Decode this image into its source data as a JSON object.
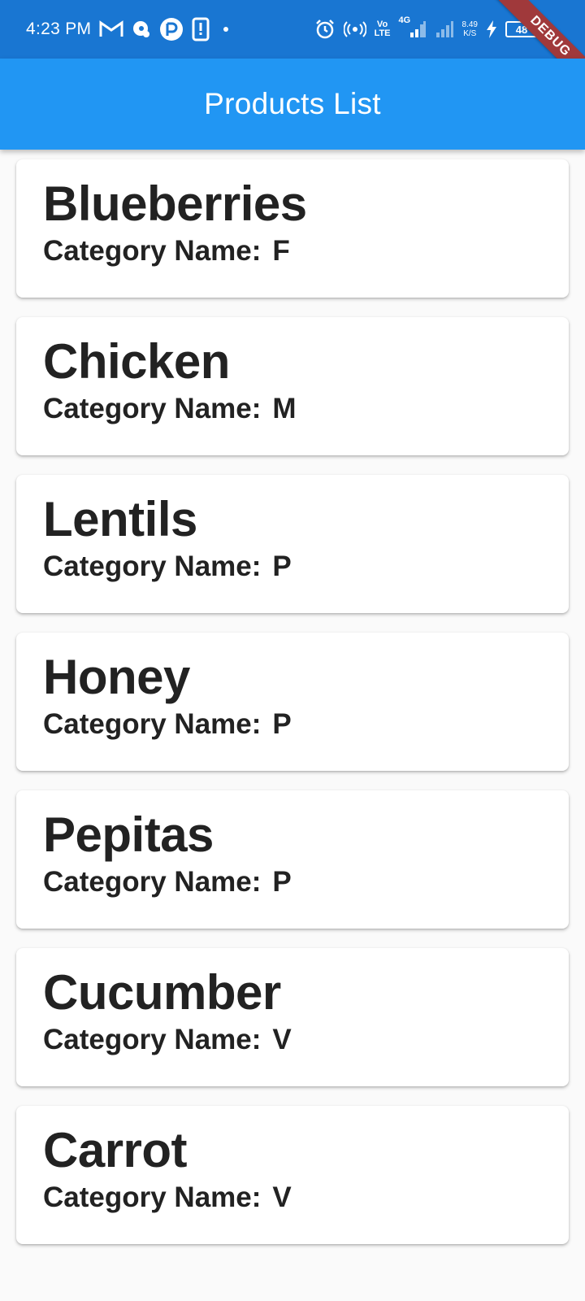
{
  "status_bar": {
    "time": "4:23 PM",
    "network_top": "Vo",
    "network_bottom": "LTE",
    "signal_label": "4G",
    "speed_value": "8.49",
    "speed_unit": "K/S",
    "battery": "48",
    "icons": [
      "gmail-icon",
      "chat-icon",
      "app-icon",
      "phone-icon",
      "dot-icon",
      "alarm-icon",
      "hotspot-icon",
      "signal-icon",
      "signal-icon",
      "charging-icon",
      "battery-icon"
    ]
  },
  "debug_banner": "DEBUG",
  "app_bar": {
    "title": "Products List"
  },
  "products": [
    {
      "name": "Blueberries",
      "category_label": "Category Name:",
      "category": "F"
    },
    {
      "name": "Chicken",
      "category_label": "Category Name:",
      "category": "M"
    },
    {
      "name": "Lentils",
      "category_label": "Category Name:",
      "category": "P"
    },
    {
      "name": "Honey",
      "category_label": "Category Name:",
      "category": "P"
    },
    {
      "name": "Pepitas",
      "category_label": "Category Name:",
      "category": "P"
    },
    {
      "name": "Cucumber",
      "category_label": "Category Name:",
      "category": "V"
    },
    {
      "name": "Carrot",
      "category_label": "Category Name:",
      "category": "V"
    }
  ],
  "colors": {
    "status_bar": "#1976d2",
    "app_bar": "#2196f3",
    "background": "#fafafa",
    "card": "#ffffff",
    "debug_ribbon": "#a0393b"
  }
}
